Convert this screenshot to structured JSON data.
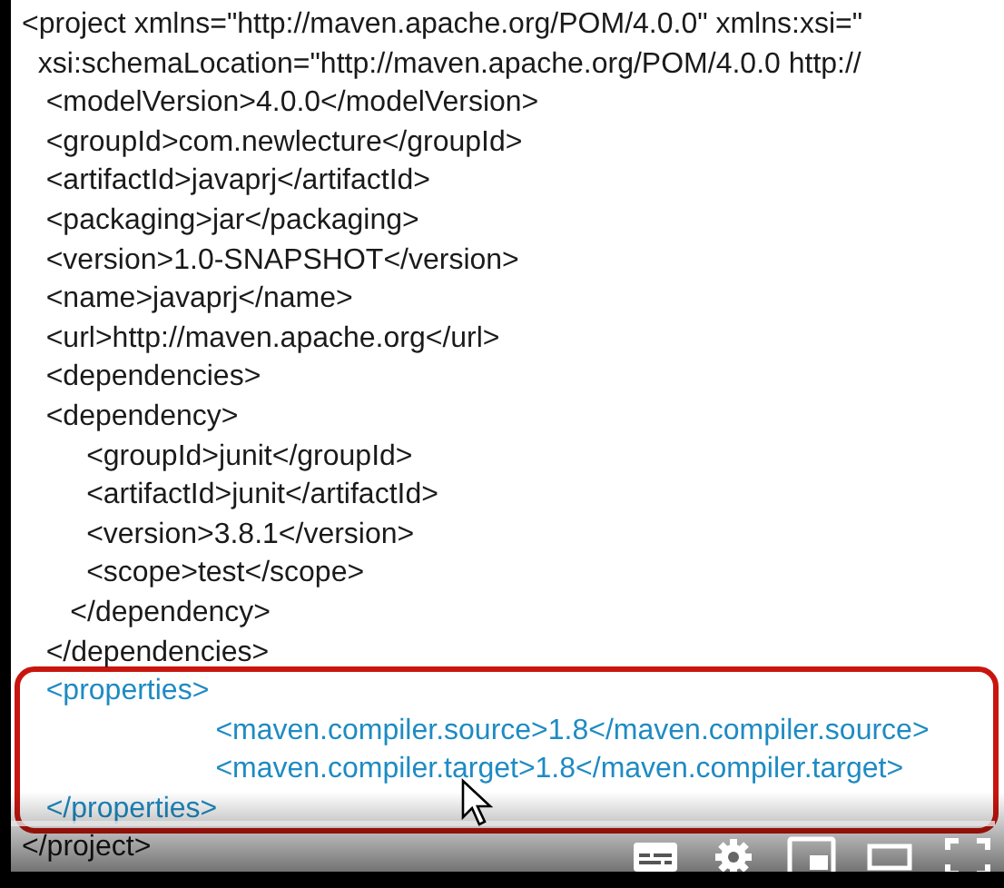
{
  "code_lines": [
    {
      "text": "<project xmlns=\"http://maven.apache.org/POM/4.0.0\" xmlns:xsi=\"",
      "highlighted": false
    },
    {
      "text": "  xsi:schemaLocation=\"http://maven.apache.org/POM/4.0.0 http://",
      "highlighted": false
    },
    {
      "text": "   <modelVersion>4.0.0</modelVersion>",
      "highlighted": false
    },
    {
      "text": "   <groupId>com.newlecture</groupId>",
      "highlighted": false
    },
    {
      "text": "   <artifactId>javaprj</artifactId>",
      "highlighted": false
    },
    {
      "text": "   <packaging>jar</packaging>",
      "highlighted": false
    },
    {
      "text": "   <version>1.0-SNAPSHOT</version>",
      "highlighted": false
    },
    {
      "text": "   <name>javaprj</name>",
      "highlighted": false
    },
    {
      "text": "   <url>http://maven.apache.org</url>",
      "highlighted": false
    },
    {
      "text": "   <dependencies>",
      "highlighted": false
    },
    {
      "text": "   <dependency>",
      "highlighted": false
    },
    {
      "text": "        <groupId>junit</groupId>",
      "highlighted": false
    },
    {
      "text": "        <artifactId>junit</artifactId>",
      "highlighted": false
    },
    {
      "text": "        <version>3.8.1</version>",
      "highlighted": false
    },
    {
      "text": "        <scope>test</scope>",
      "highlighted": false
    },
    {
      "text": "      </dependency>",
      "highlighted": false
    },
    {
      "text": "   </dependencies>",
      "highlighted": false
    },
    {
      "text": "   <properties>",
      "highlighted": true
    },
    {
      "text": "                        <maven.compiler.source>1.8</maven.compiler.source>",
      "highlighted": true
    },
    {
      "text": "                        <maven.compiler.target>1.8</maven.compiler.target>",
      "highlighted": true
    },
    {
      "text": "   </properties>",
      "highlighted": true
    },
    {
      "text": "</project>",
      "highlighted": false
    }
  ],
  "player_controls": [
    {
      "kind": "subtitles"
    },
    {
      "kind": "settings"
    },
    {
      "kind": "miniplayer"
    },
    {
      "kind": "theater"
    },
    {
      "kind": "fullscreen"
    }
  ]
}
